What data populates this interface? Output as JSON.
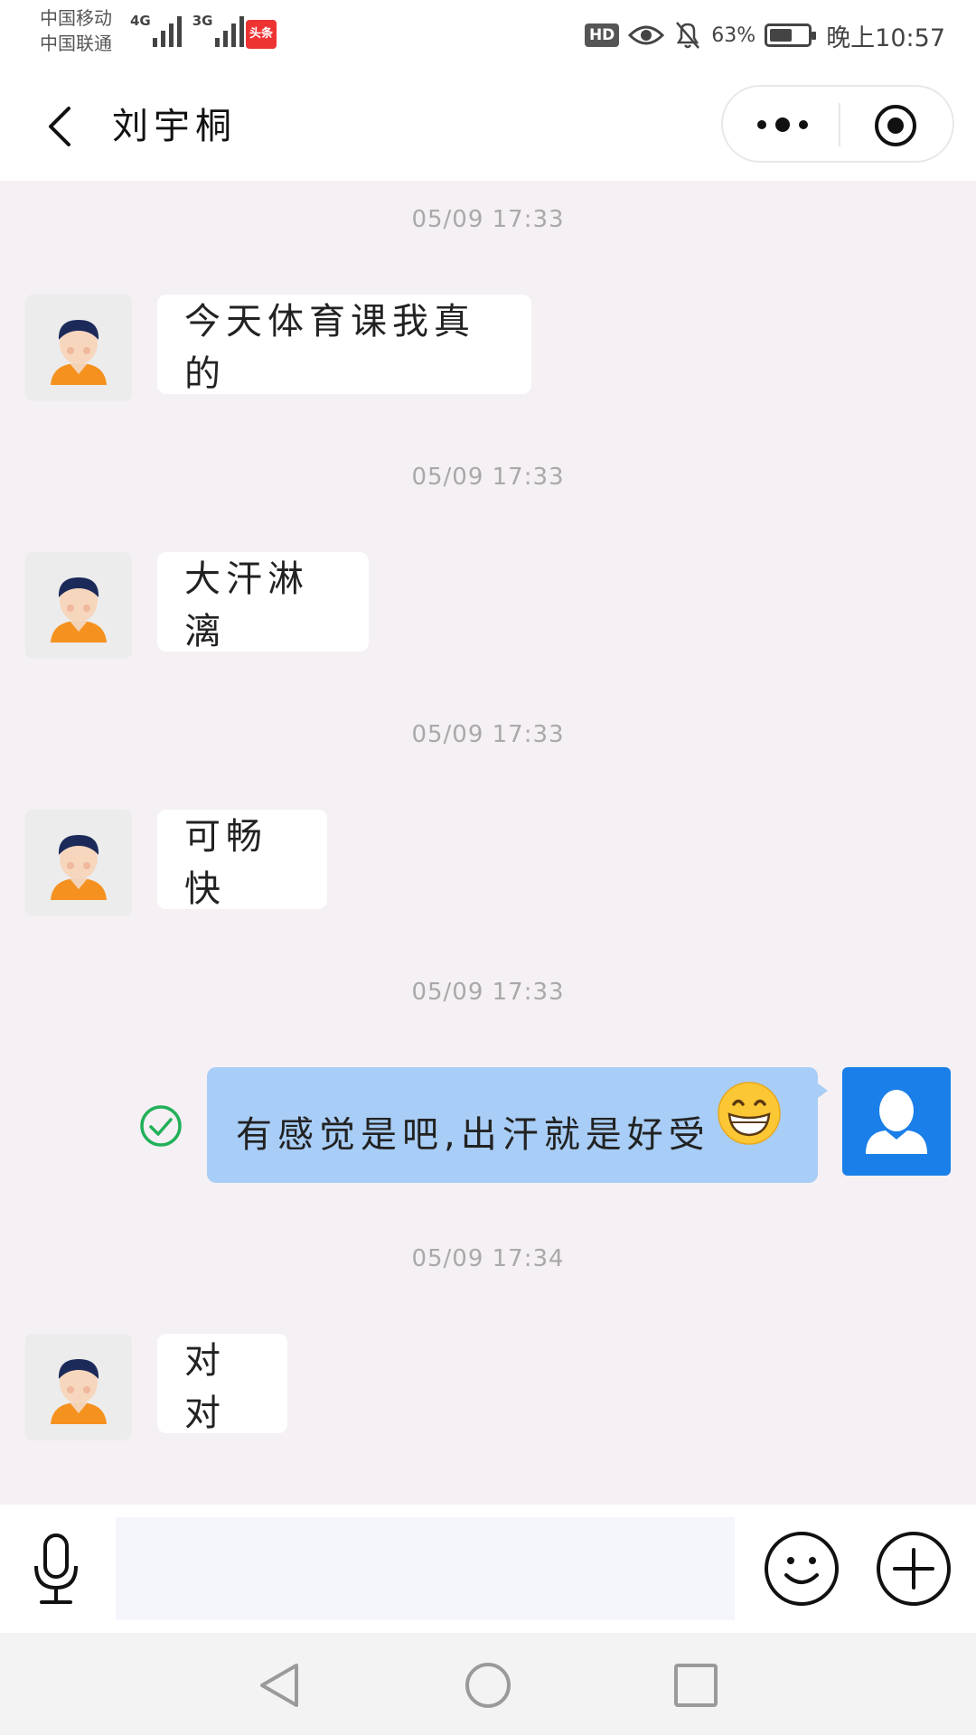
{
  "status_bar": {
    "carrier_1": "中国移动",
    "carrier_2": "中国联通",
    "network_1": "4G",
    "network_2": "3G",
    "app_badge": "头条",
    "hd_label": "HD",
    "battery_percent": "63%",
    "battery_level": 0.63,
    "time": "晚上10:57"
  },
  "header": {
    "title": "刘宇桐"
  },
  "messages": [
    {
      "time": "05/09 17:33",
      "sender": "other",
      "text": "今天体育课我真的"
    },
    {
      "time": "05/09 17:33",
      "sender": "other",
      "text": "大汗淋漓"
    },
    {
      "time": "05/09 17:33",
      "sender": "other",
      "text": "可畅快"
    },
    {
      "time": "05/09 17:33",
      "sender": "me",
      "text": "有感觉是吧,出汗就是好受",
      "emoji": "grinning-face",
      "status": "delivered"
    },
    {
      "time": "05/09 17:34",
      "sender": "other",
      "text": "对对"
    }
  ],
  "input": {
    "placeholder": "",
    "value": ""
  },
  "colors": {
    "chat_background": "#f5f0f3",
    "my_bubble": "#a8cdf6",
    "my_avatar": "#1a7fe8",
    "check_green": "#22b05a"
  }
}
